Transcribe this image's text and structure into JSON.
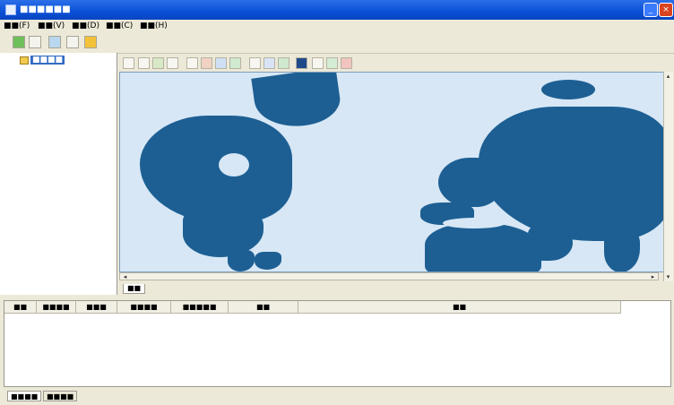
{
  "window": {
    "title": "■■■■■■"
  },
  "menubar": {
    "items": [
      "■■(F)",
      "■■(V)",
      "■■(D)",
      "■■(C)",
      "■■(H)"
    ]
  },
  "toolbar": {
    "icons": [
      "add-icon",
      "edit-icon",
      "refresh-icon",
      "list-icon",
      "warning-icon"
    ]
  },
  "tree": {
    "root_label": "■■■■"
  },
  "map_toolbar": {
    "icons": [
      "select-icon",
      "pan-icon",
      "zoom-in-icon",
      "zoom-out-icon",
      "left-icon",
      "right-icon",
      "grid-icon",
      "layers-icon",
      "info-icon",
      "table-icon",
      "settings-icon",
      "rect-icon",
      "line-icon",
      "help-icon",
      "close-icon"
    ]
  },
  "map_tabs": {
    "view_label": "■■"
  },
  "bottom_table": {
    "columns": [
      "■■",
      "■■■■",
      "■■■",
      "■■■■",
      "■■■■■",
      "■■",
      "■■"
    ]
  },
  "bottom_tabs": {
    "items": [
      "■■■■",
      "■■■■"
    ]
  },
  "colors": {
    "title_bar": "#0a4fd6",
    "ocean": "#d7e7f5",
    "land": "#1d5f93",
    "selection": "#316ac5"
  }
}
